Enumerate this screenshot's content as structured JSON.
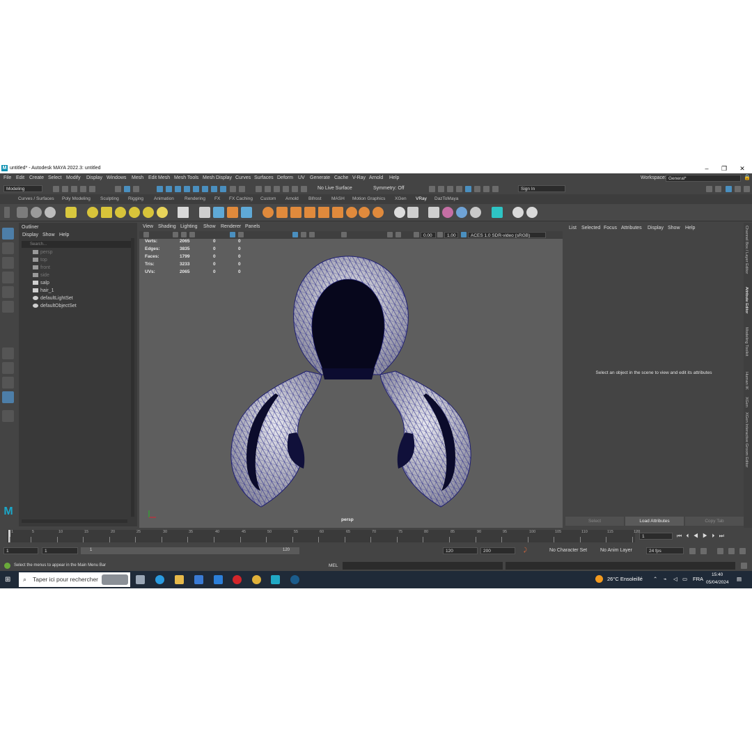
{
  "window": {
    "title": "untitled* - Autodesk MAYA 2022.3: untitled",
    "logo_letter": "M",
    "controls": [
      "–",
      "❐",
      "✕"
    ]
  },
  "menubar": {
    "items": [
      "File",
      "Edit",
      "Create",
      "Select",
      "Modify",
      "Display",
      "Windows",
      "Mesh",
      "Edit Mesh",
      "Mesh Tools",
      "Mesh Display",
      "Curves",
      "Surfaces",
      "Deform",
      "UV",
      "Generate",
      "Cache",
      "V-Ray",
      "Arnold",
      "Help"
    ],
    "workspace_label": "Workspace:",
    "workspace_value": "General*"
  },
  "statusline": {
    "menuset": "Modeling",
    "live_surface": "No Live Surface",
    "symmetry": "Symmetry: Off",
    "sign_in": "Sign In"
  },
  "shelf": {
    "tabs": [
      "Curves / Surfaces",
      "Poly Modeling",
      "Sculpting",
      "Rigging",
      "Animation",
      "Rendering",
      "FX",
      "FX Caching",
      "Custom",
      "Arnold",
      "Bifrost",
      "MASH",
      "Motion Graphics",
      "XGen",
      "VRay",
      "DazToMaya"
    ],
    "active_tab": "VRay"
  },
  "outliner": {
    "title": "Outliner",
    "menu": [
      "Display",
      "Show",
      "Help"
    ],
    "search_placeholder": "Search...",
    "items": [
      {
        "label": "persp",
        "dim": true
      },
      {
        "label": "top",
        "dim": true
      },
      {
        "label": "front",
        "dim": true
      },
      {
        "label": "side",
        "dim": true
      },
      {
        "label": "salp",
        "dim": false
      },
      {
        "label": "hair_1",
        "dim": false
      },
      {
        "label": "defaultLightSet",
        "dim": false
      },
      {
        "label": "defaultObjectSet",
        "dim": false
      }
    ]
  },
  "viewport": {
    "menu": [
      "View",
      "Shading",
      "Lighting",
      "Show",
      "Renderer",
      "Panels"
    ],
    "exposure": "0.00",
    "gamma": "1.00",
    "colorspace": "ACES 1.0 SDR-video (sRGB)",
    "camera_label": "persp",
    "hud": [
      {
        "label": "Verts:",
        "value": "2065",
        "c1": "0",
        "c2": "0"
      },
      {
        "label": "Edges:",
        "value": "3835",
        "c1": "0",
        "c2": "0"
      },
      {
        "label": "Faces:",
        "value": "1799",
        "c1": "0",
        "c2": "0"
      },
      {
        "label": "Tris:",
        "value": "3233",
        "c1": "0",
        "c2": "0"
      },
      {
        "label": "UVs:",
        "value": "2065",
        "c1": "0",
        "c2": "0"
      }
    ]
  },
  "attribute_editor": {
    "menu": [
      "List",
      "Selected",
      "Focus",
      "Attributes",
      "Display",
      "Show",
      "Help"
    ],
    "message": "Select an object in the scene to view and edit its attributes",
    "buttons": [
      "Select",
      "Load Attributes",
      "Copy Tab"
    ]
  },
  "right_tabs": [
    "Channel Box / Layer Editor",
    "Attribute Editor",
    "Modeling Toolkit",
    "Human IK",
    "XGen",
    "XGen Interactive Groom Editor"
  ],
  "timeslider": {
    "ticks": [
      "1",
      "5",
      "10",
      "15",
      "20",
      "25",
      "30",
      "35",
      "40",
      "45",
      "50",
      "55",
      "60",
      "65",
      "70",
      "75",
      "80",
      "85",
      "90",
      "95",
      "100",
      "105",
      "110",
      "115",
      "120"
    ],
    "current_frame": "1"
  },
  "range": {
    "start": "1",
    "start2": "1",
    "range_start_label": "1",
    "range_end_label": "120",
    "end": "120",
    "end2": "200",
    "character_set": "No Character Set",
    "anim_layer": "No Anim Layer",
    "fps": "24 fps"
  },
  "helpline": {
    "message": "Select the menus to appear in the Main Menu Bar",
    "mel_label": "MEL"
  },
  "taskbar": {
    "search_placeholder": "Taper ici pour rechercher",
    "weather": "26°C  Ensoleillé",
    "lang": "FRA",
    "time": "15:40",
    "date": "05/04/2024"
  }
}
